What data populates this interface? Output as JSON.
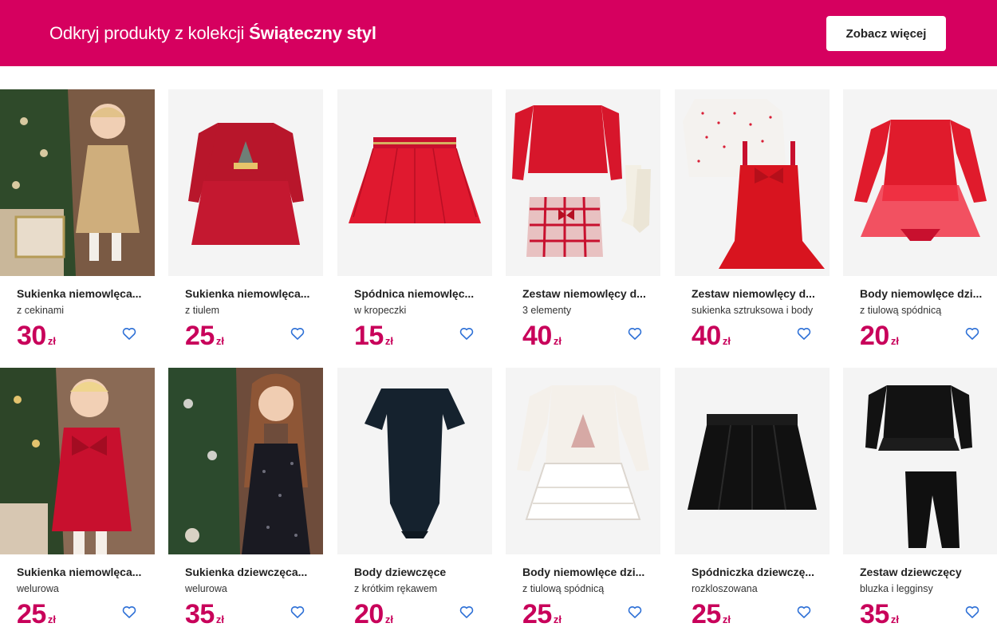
{
  "banner": {
    "title_prefix": "Odkryj produkty z kolekcji ",
    "title_collection": "Świąteczny styl",
    "see_more_label": "Zobacz więcej",
    "background": "#d6005f"
  },
  "currency": "zł",
  "price_color": "#c8005a",
  "products": [
    {
      "name": "Sukienka niemowlęca...",
      "sub": "z cekinami",
      "price": "30",
      "image": "photo-girl-sequin-dress",
      "fav_icon": "heart-outline-icon"
    },
    {
      "name": "Sukienka niemowlęca...",
      "sub": "z tiulem",
      "price": "25",
      "image": "red-tulle-dress-tree",
      "fav_icon": "heart-outline-icon"
    },
    {
      "name": "Spódnica niemowlęc...",
      "sub": "w kropeczki",
      "price": "15",
      "image": "red-tulle-skirt",
      "fav_icon": "heart-outline-icon"
    },
    {
      "name": "Zestaw niemowlęcy d...",
      "sub": "3 elementy",
      "price": "40",
      "image": "red-set-top-skirt-tights",
      "fav_icon": "heart-outline-icon"
    },
    {
      "name": "Zestaw niemowlęcy d...",
      "sub": "sukienka sztruksowa i body",
      "price": "40",
      "image": "red-pinafore-white-body",
      "fav_icon": "heart-outline-icon"
    },
    {
      "name": "Body niemowlęce dzi...",
      "sub": "z tiulową spódnicą",
      "price": "20",
      "image": "red-tulle-body",
      "fav_icon": "heart-outline-icon"
    },
    {
      "name": "Sukienka niemowlęca...",
      "sub": "welurowa",
      "price": "25",
      "image": "photo-girl-red-dress",
      "fav_icon": "heart-outline-icon"
    },
    {
      "name": "Sukienka dziewczęca...",
      "sub": "welurowa",
      "price": "35",
      "image": "photo-girl-black-dress",
      "fav_icon": "heart-outline-icon"
    },
    {
      "name": "Body dziewczęce",
      "sub": "z krótkim rękawem",
      "price": "20",
      "image": "navy-velvet-body",
      "fav_icon": "heart-outline-icon"
    },
    {
      "name": "Body niemowlęce dzi...",
      "sub": "z tiulową spódnicą",
      "price": "25",
      "image": "white-tulle-body-tree",
      "fav_icon": "heart-outline-icon"
    },
    {
      "name": "Spódniczka dziewczę...",
      "sub": "rozkloszowana",
      "price": "25",
      "image": "black-leather-skirt",
      "fav_icon": "heart-outline-icon"
    },
    {
      "name": "Zestaw dziewczęcy",
      "sub": "bluzka i legginsy",
      "price": "35",
      "image": "black-top-leggings",
      "fav_icon": "heart-outline-icon"
    }
  ]
}
